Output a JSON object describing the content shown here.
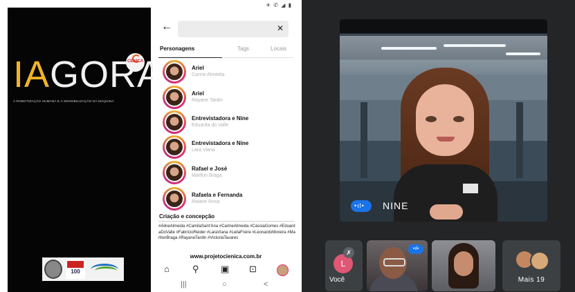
{
  "poster": {
    "logo_accent": "IA",
    "logo_rest": "GORA",
    "badge_text": "CENICA",
    "tagline": "A ROBOTIZAÇÃO HUMANA E A SENSIBILIZAÇÃO DA MÁQUINA",
    "university_mark": "100",
    "colors": {
      "accent": "#f0b429",
      "background": "#050505"
    }
  },
  "phone": {
    "status_icons": "✈ ✆ ◢ ▮",
    "back_icon": "arrow-left",
    "clear_icon": "close",
    "tabs": [
      {
        "label": "Personagens",
        "active": true
      },
      {
        "label": "Tags",
        "active": false
      },
      {
        "label": "Locais",
        "active": false
      }
    ],
    "results": [
      {
        "title": "Ariel",
        "subtitle": "Carine Almeida"
      },
      {
        "title": "Ariel",
        "subtitle": "Rayane Tardin"
      },
      {
        "title": "Entrevistadora e Nine",
        "subtitle": "Eduarda do Valle"
      },
      {
        "title": "Entrevistadora e Nine",
        "subtitle": "Lara Viana"
      },
      {
        "title": "Rafael e José",
        "subtitle": "Marllon Braga"
      },
      {
        "title": "Rafaela e Fernanda",
        "subtitle": "Raiane Rosa"
      }
    ],
    "credits_heading": "Criação e concepção",
    "credits_text": "#AlineAlmeida #CamilaSant'Ana #CarineAlmeida #CássiaGomes #EduardaDoValle #FabrícioReider #LaraViana #LeilaFreire #LeonardoMoreira #MarllonBraga #RayaneTardin #VictoriaTavares",
    "website": "www.projetocienica.com.br",
    "nav_icons": [
      "home-icon",
      "search-icon",
      "reels-icon",
      "shop-icon",
      "profile-avatar"
    ],
    "nav_glyphs": {
      "home": "⌂",
      "search": "⚲",
      "reels": "▣",
      "shop": "⊡"
    },
    "system_nav": {
      "recent": "|||",
      "home": "○",
      "back": "<"
    }
  },
  "call": {
    "main_speaker": "NINE",
    "mic_indicator": "•ıl•",
    "participants": [
      {
        "name": "Você",
        "initial": "L",
        "muted": true
      },
      {
        "name": "",
        "speaking": true,
        "mic_indicator": "•ıl•"
      },
      {
        "name": ""
      },
      {
        "name": "Mais 19"
      }
    ],
    "colors": {
      "accent": "#1a73e8",
      "tile": "#3c4043",
      "self_avatar": "#e05774"
    }
  }
}
